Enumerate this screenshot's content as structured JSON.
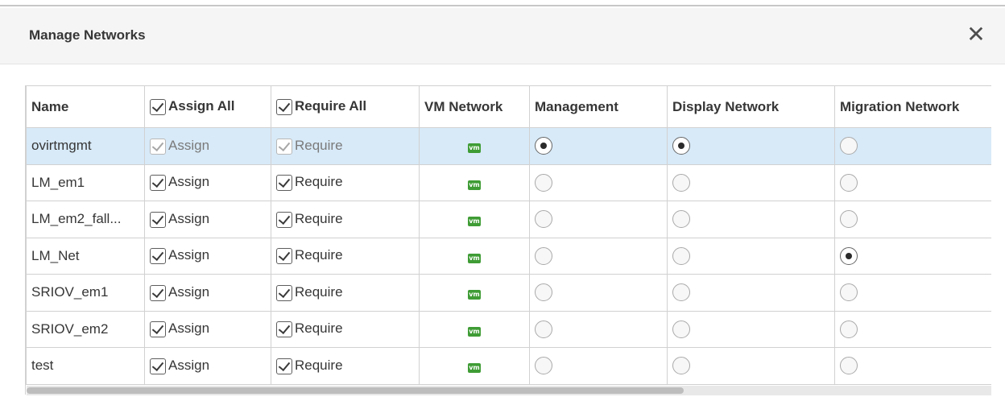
{
  "dialog": {
    "title": "Manage Networks",
    "close_glyph": "✕"
  },
  "columns": {
    "name": "Name",
    "assign_all": "Assign All",
    "require_all": "Require All",
    "vm_network": "VM Network",
    "management": "Management",
    "display_network": "Display Network",
    "migration_network": "Migration Network"
  },
  "rows": [
    {
      "name": "ovirtmgmt",
      "assign": "Assign",
      "require": "Require",
      "vm_icon": "vm",
      "disabled": true,
      "selected": true,
      "management": true,
      "display": true,
      "migration": false
    },
    {
      "name": "LM_em1",
      "assign": "Assign",
      "require": "Require",
      "vm_icon": "vm",
      "management": false,
      "display": false,
      "migration": false
    },
    {
      "name": "LM_em2_fall...",
      "assign": "Assign",
      "require": "Require",
      "vm_icon": "vm",
      "management": false,
      "display": false,
      "migration": false
    },
    {
      "name": "LM_Net",
      "assign": "Assign",
      "require": "Require",
      "vm_icon": "vm",
      "management": false,
      "display": false,
      "migration": true
    },
    {
      "name": "SRIOV_em1",
      "assign": "Assign",
      "require": "Require",
      "vm_icon": "vm",
      "management": false,
      "display": false,
      "migration": false
    },
    {
      "name": "SRIOV_em2",
      "assign": "Assign",
      "require": "Require",
      "vm_icon": "vm",
      "management": false,
      "display": false,
      "migration": false
    },
    {
      "name": "test",
      "assign": "Assign",
      "require": "Require",
      "vm_icon": "vm",
      "management": false,
      "display": false,
      "migration": false
    }
  ],
  "icons": {
    "checkbox": "checkbox-checked-icon",
    "vm_network": "vm-network-icon",
    "radio": "radio-icon",
    "close": "close-icon"
  }
}
